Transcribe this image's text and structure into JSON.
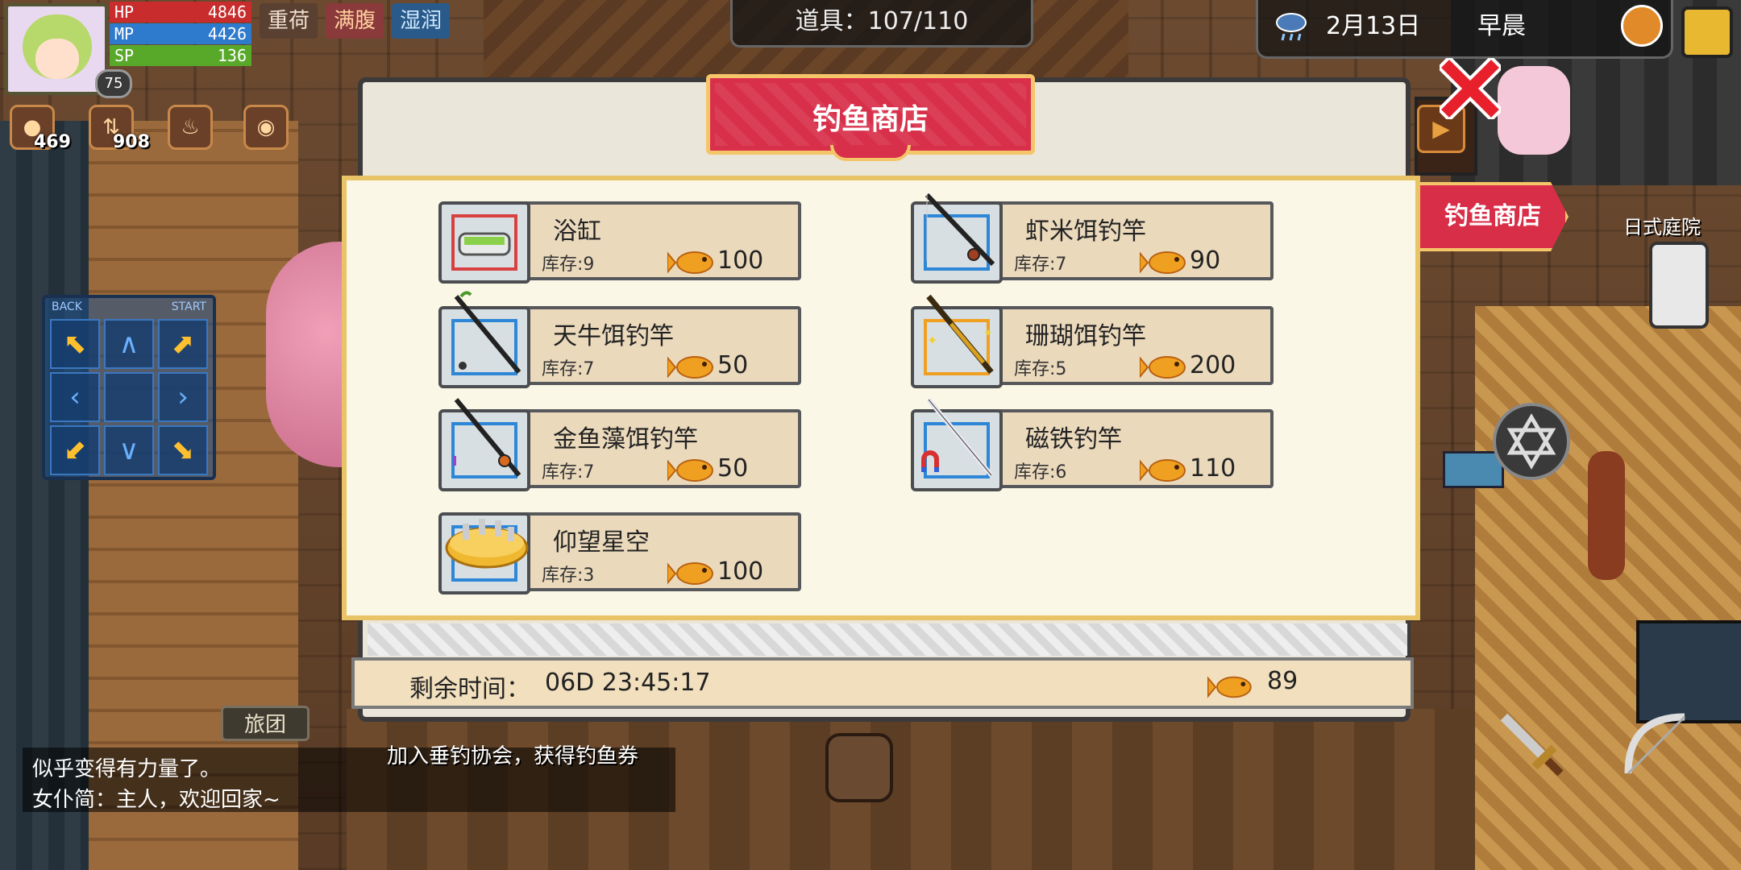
{
  "hud": {
    "hp_label": "HP",
    "hp_value": "4846",
    "mp_label": "MP",
    "mp_value": "4426",
    "sp_label": "SP",
    "sp_value": "136",
    "level": "75",
    "status_tags": [
      "重荷",
      "满腹",
      "湿润"
    ],
    "coins": "469",
    "sort_count": "908",
    "items_label": "道具：107/110",
    "date": "2月13日",
    "time_of_day": "早晨"
  },
  "dpad": {
    "back_label": "BACK",
    "start_label": "START"
  },
  "shop": {
    "title": "钓鱼商店",
    "side_tab": "钓鱼商店",
    "items": [
      {
        "name": "浴缸",
        "stock": "库存:9",
        "price": "100",
        "icon": "bathtub-icon"
      },
      {
        "name": "虾米饵钓竿",
        "stock": "库存:7",
        "price": "90",
        "icon": "fishing-rod-icon"
      },
      {
        "name": "天牛饵钓竿",
        "stock": "库存:7",
        "price": "50",
        "icon": "fishing-rod-icon"
      },
      {
        "name": "珊瑚饵钓竿",
        "stock": "库存:5",
        "price": "200",
        "icon": "golden-rod-icon"
      },
      {
        "name": "金鱼藻饵钓竿",
        "stock": "库存:7",
        "price": "50",
        "icon": "fishing-rod-icon"
      },
      {
        "name": "磁铁钓竿",
        "stock": "库存:6",
        "price": "110",
        "icon": "magnet-rod-icon"
      },
      {
        "name": "仰望星空",
        "stock": "库存:3",
        "price": "100",
        "icon": "star-cake-icon"
      }
    ],
    "remaining_label": "剩余时间：",
    "remaining_value": "06D 23:45:17",
    "coupon_count": "89"
  },
  "chat": {
    "line1": "似乎变得有力量了。",
    "line2": "女仆简：主人，欢迎回家~",
    "quest_hint": "加入垂钓协会，获得钓鱼券"
  },
  "bottom_tabs": {
    "tour": "旅团"
  },
  "map_labels": {
    "garden": "日式庭院"
  },
  "colors": {
    "accent_red": "#d8304a",
    "gold_border": "#f5c56a",
    "fish_gold": "#f0a020"
  }
}
